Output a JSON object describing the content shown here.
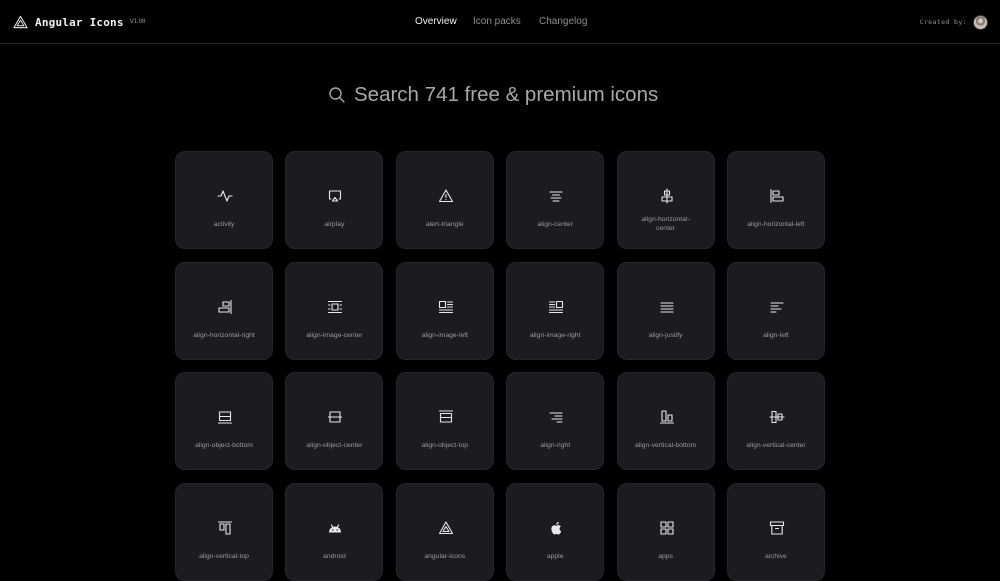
{
  "header": {
    "brand_name": "Angular Icons",
    "brand_version": "V1.08",
    "nav": [
      {
        "label": "Overview",
        "active": true
      },
      {
        "label": "Icon packs",
        "active": false
      },
      {
        "label": "Changelog",
        "active": false
      }
    ],
    "created_by_label": "Created by:"
  },
  "search": {
    "placeholder": "Search 741 free & premium icons"
  },
  "icons": [
    {
      "label": "activity",
      "icon": "activity-icon"
    },
    {
      "label": "airplay",
      "icon": "airplay-icon"
    },
    {
      "label": "alert-triangle",
      "icon": "alert-triangle-icon"
    },
    {
      "label": "align-center",
      "icon": "align-center-icon"
    },
    {
      "label": "align-horizontal-center",
      "icon": "align-horizontal-center-icon"
    },
    {
      "label": "align-horizontal-left",
      "icon": "align-horizontal-left-icon"
    },
    {
      "label": "align-horizontal-right",
      "icon": "align-horizontal-right-icon"
    },
    {
      "label": "align-image-center",
      "icon": "align-image-center-icon"
    },
    {
      "label": "align-image-left",
      "icon": "align-image-left-icon"
    },
    {
      "label": "align-image-right",
      "icon": "align-image-right-icon"
    },
    {
      "label": "align-justify",
      "icon": "align-justify-icon"
    },
    {
      "label": "align-left",
      "icon": "align-left-icon"
    },
    {
      "label": "align-object-bottom",
      "icon": "align-object-bottom-icon"
    },
    {
      "label": "align-object-center",
      "icon": "align-object-center-icon"
    },
    {
      "label": "align-object-top",
      "icon": "align-object-top-icon"
    },
    {
      "label": "align-right",
      "icon": "align-right-icon"
    },
    {
      "label": "align-vertical-bottom",
      "icon": "align-vertical-bottom-icon"
    },
    {
      "label": "align-vertical-center",
      "icon": "align-vertical-center-icon"
    },
    {
      "label": "align-vertical-top",
      "icon": "align-vertical-top-icon"
    },
    {
      "label": "android",
      "icon": "android-icon"
    },
    {
      "label": "angular-icons",
      "icon": "angular-icons-icon"
    },
    {
      "label": "apple",
      "icon": "apple-icon"
    },
    {
      "label": "apps",
      "icon": "apps-icon"
    },
    {
      "label": "archive",
      "icon": "archive-icon"
    }
  ],
  "colors": {
    "background": "#000000",
    "card": "#1c1c1e",
    "text_primary": "#f0f0f0",
    "text_muted": "#9a9a9a"
  }
}
